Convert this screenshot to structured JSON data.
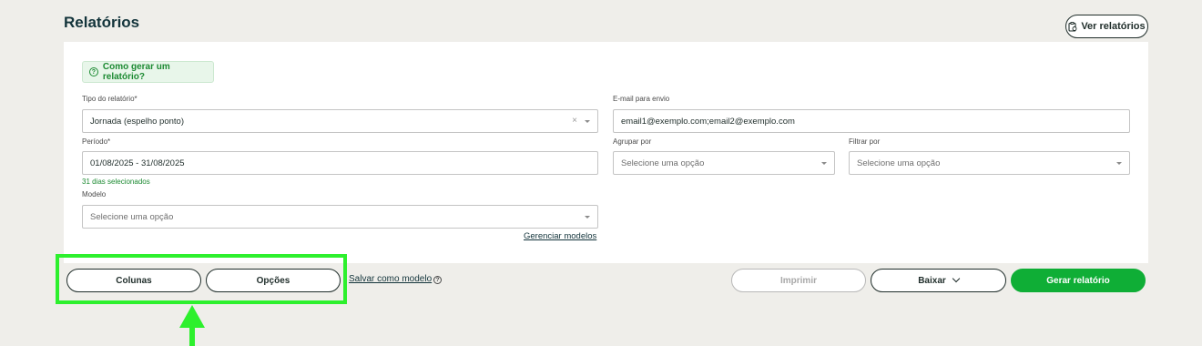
{
  "page": {
    "title": "Relatórios"
  },
  "header": {
    "view_reports_label": "Ver relatórios",
    "view_reports_icon": "clipboard-icon"
  },
  "help": {
    "label": "Como gerar um relatório?",
    "icon": "question-circle-icon"
  },
  "form": {
    "report_type": {
      "label": "Tipo do relatório*",
      "value": "Jornada (espelho ponto)",
      "clear_glyph": "×"
    },
    "email": {
      "label": "E-mail para envio",
      "value": "email1@exemplo.com;email2@exemplo.com"
    },
    "period": {
      "label": "Período*",
      "value": "01/08/2025 - 31/08/2025",
      "hint": "31 dias selecionados"
    },
    "group_by": {
      "label": "Agrupar por",
      "placeholder": "Selecione uma opção"
    },
    "filter_by": {
      "label": "Filtrar por",
      "placeholder": "Selecione uma opção"
    },
    "model": {
      "label": "Modelo",
      "placeholder": "Selecione uma opção"
    },
    "manage_models_label": "Gerenciar modelos"
  },
  "actions": {
    "columns_label": "Colunas",
    "options_label": "Opções",
    "save_model_label": "Salvar como modelo",
    "save_model_help_glyph": "?",
    "print_label": "Imprimir",
    "download_label": "Baixar",
    "generate_label": "Gerar relatório"
  },
  "annotation": {
    "color": "#2df02d"
  },
  "colors": {
    "primary": "#0fae36",
    "background": "#efeeea",
    "title": "#13343b"
  }
}
